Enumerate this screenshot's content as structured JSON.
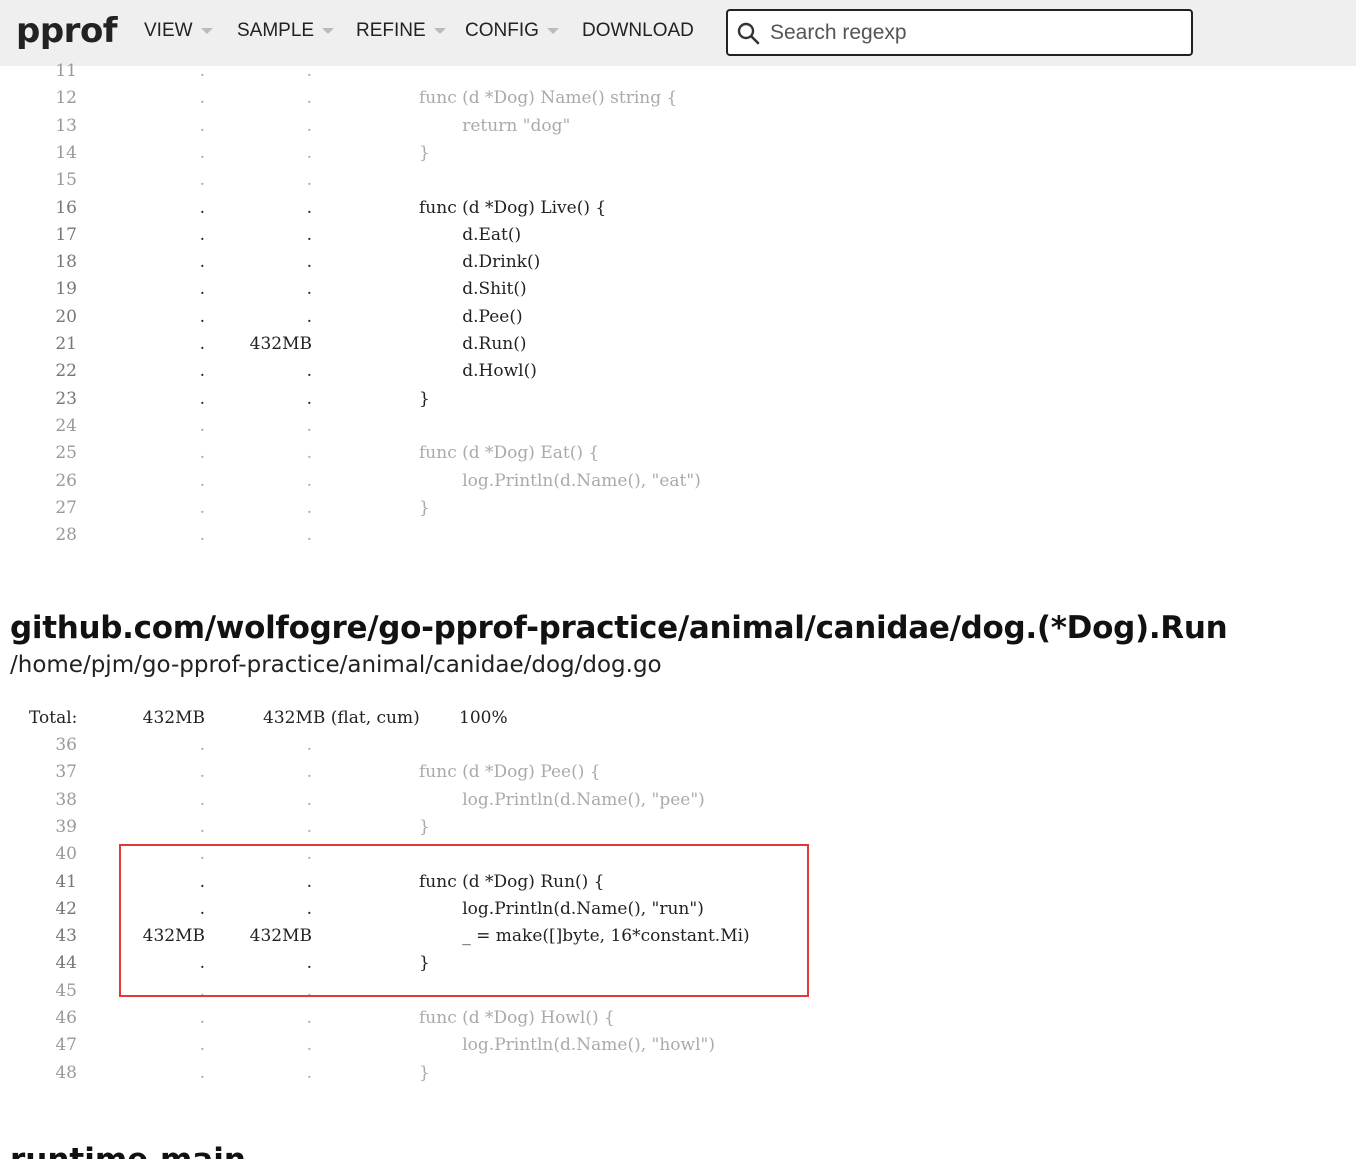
{
  "header": {
    "logo": "pprof",
    "menus": [
      "VIEW",
      "SAMPLE",
      "REFINE",
      "CONFIG",
      "DOWNLOAD"
    ],
    "search_placeholder": "Search regexp"
  },
  "listing1": {
    "rows": [
      {
        "ln": "11",
        "flat": ".",
        "cum": ".",
        "src": "",
        "style": "faded"
      },
      {
        "ln": "12",
        "flat": ".",
        "cum": ".",
        "src": "func (d *Dog) Name() string {",
        "style": "faded"
      },
      {
        "ln": "13",
        "flat": ".",
        "cum": ".",
        "src": "        return \"dog\"",
        "style": "faded"
      },
      {
        "ln": "14",
        "flat": ".",
        "cum": ".",
        "src": "}",
        "style": "faded"
      },
      {
        "ln": "15",
        "flat": ".",
        "cum": ".",
        "src": "",
        "style": "faded"
      },
      {
        "ln": "16",
        "flat": ".",
        "cum": ".",
        "src": "func (d *Dog) Live() {",
        "style": "dark"
      },
      {
        "ln": "17",
        "flat": ".",
        "cum": ".",
        "src": "        d.Eat()",
        "style": "dark"
      },
      {
        "ln": "18",
        "flat": ".",
        "cum": ".",
        "src": "        d.Drink()",
        "style": "dark"
      },
      {
        "ln": "19",
        "flat": ".",
        "cum": ".",
        "src": "        d.Shit()",
        "style": "dark"
      },
      {
        "ln": "20",
        "flat": ".",
        "cum": ".",
        "src": "        d.Pee()",
        "style": "dark"
      },
      {
        "ln": "21",
        "flat": ".",
        "cum": "432MB",
        "src": "        d.Run()",
        "style": "dark"
      },
      {
        "ln": "22",
        "flat": ".",
        "cum": ".",
        "src": "        d.Howl()",
        "style": "dark"
      },
      {
        "ln": "23",
        "flat": ".",
        "cum": ".",
        "src": "}",
        "style": "dark"
      },
      {
        "ln": "24",
        "flat": ".",
        "cum": ".",
        "src": "",
        "style": "faded"
      },
      {
        "ln": "25",
        "flat": ".",
        "cum": ".",
        "src": "func (d *Dog) Eat() {",
        "style": "faded"
      },
      {
        "ln": "26",
        "flat": ".",
        "cum": ".",
        "src": "        log.Println(d.Name(), \"eat\")",
        "style": "faded"
      },
      {
        "ln": "27",
        "flat": ".",
        "cum": ".",
        "src": "}",
        "style": "faded"
      },
      {
        "ln": "28",
        "flat": ".",
        "cum": ".",
        "src": "",
        "style": "faded"
      }
    ]
  },
  "function2": {
    "title": "github.com/wolfogre/go-pprof-practice/animal/canidae/dog.(*Dog).Run",
    "path": "/home/pjm/go-pprof-practice/animal/canidae/dog/dog.go",
    "total": {
      "label": "Total:",
      "flat": "432MB",
      "cum": "432MB (flat, cum)",
      "pct": "100%"
    },
    "rows": [
      {
        "ln": "36",
        "flat": ".",
        "cum": ".",
        "src": "",
        "style": "faded"
      },
      {
        "ln": "37",
        "flat": ".",
        "cum": ".",
        "src": "func (d *Dog) Pee() {",
        "style": "faded"
      },
      {
        "ln": "38",
        "flat": ".",
        "cum": ".",
        "src": "        log.Println(d.Name(), \"pee\")",
        "style": "faded"
      },
      {
        "ln": "39",
        "flat": ".",
        "cum": ".",
        "src": "}",
        "style": "faded"
      },
      {
        "ln": "40",
        "flat": ".",
        "cum": ".",
        "src": "",
        "style": "faded"
      },
      {
        "ln": "41",
        "flat": ".",
        "cum": ".",
        "src": "func (d *Dog) Run() {",
        "style": "dark"
      },
      {
        "ln": "42",
        "flat": ".",
        "cum": ".",
        "src": "        log.Println(d.Name(), \"run\")",
        "style": "dark"
      },
      {
        "ln": "43",
        "flat": "432MB",
        "cum": "432MB",
        "src": "        _ = make([]byte, 16*constant.Mi)",
        "style": "dark"
      },
      {
        "ln": "44",
        "flat": ".",
        "cum": ".",
        "src": "}",
        "style": "dark"
      },
      {
        "ln": "45",
        "flat": ".",
        "cum": ".",
        "src": "",
        "style": "faded"
      },
      {
        "ln": "46",
        "flat": ".",
        "cum": ".",
        "src": "func (d *Dog) Howl() {",
        "style": "faded"
      },
      {
        "ln": "47",
        "flat": ".",
        "cum": ".",
        "src": "        log.Println(d.Name(), \"howl\")",
        "style": "faded"
      },
      {
        "ln": "48",
        "flat": ".",
        "cum": ".",
        "src": "}",
        "style": "faded"
      }
    ]
  },
  "next_section_title": "runtime.main"
}
